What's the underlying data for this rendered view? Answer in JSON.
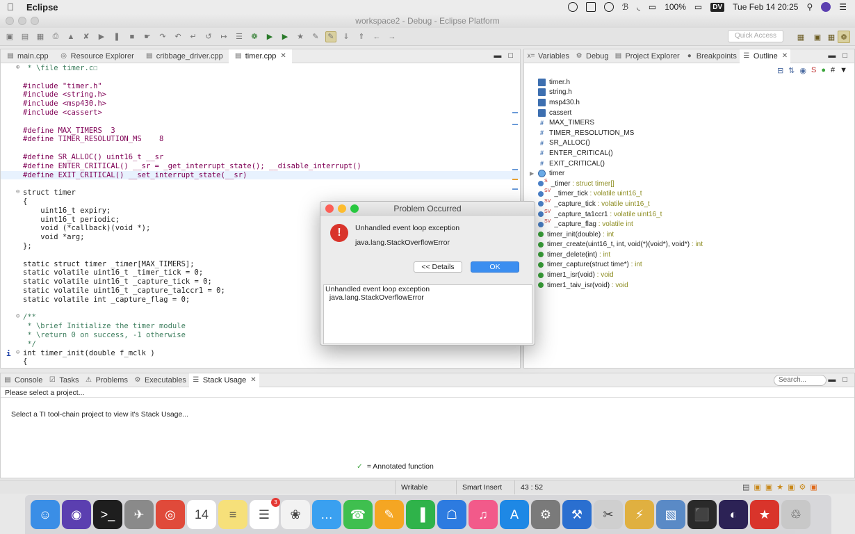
{
  "menubar": {
    "app": "Eclipse",
    "battery": "100%",
    "user_badge": "DV",
    "clock": "Tue Feb 14  20:25"
  },
  "window": {
    "title": "workspace2 - Debug - Eclipse Platform"
  },
  "toolbar": {
    "quick_access_placeholder": "Quick Access"
  },
  "editor": {
    "tabs": [
      {
        "label": "main.cpp",
        "icon": "file-icon"
      },
      {
        "label": "Resource Explorer",
        "icon": "compass-icon"
      },
      {
        "label": "cribbage_driver.cpp",
        "icon": "file-icon"
      },
      {
        "label": "timer.cpp",
        "icon": "file-icon",
        "active": true
      }
    ],
    "code": [
      " * \\file timer.c☐",
      "",
      "#include \"timer.h\"",
      "#include <string.h>",
      "#include <msp430.h>",
      "#include <cassert>",
      "",
      "#define MAX_TIMERS  3",
      "#define TIMER_RESOLUTION_MS    8",
      "",
      "#define SR_ALLOC() uint16_t __sr",
      "#define ENTER_CRITICAL() __sr = _get_interrupt_state(); __disable_interrupt()",
      "#define EXIT_CRITICAL() __set_interrupt_state(__sr)",
      "",
      "struct timer",
      "{",
      "    uint16_t expiry;",
      "    uint16_t periodic;",
      "    void (*callback)(void *);",
      "    void *arg;",
      "};",
      "",
      "static struct timer _timer[MAX_TIMERS];",
      "static volatile uint16_t _timer_tick = 0;",
      "static volatile uint16_t _capture_tick = 0;",
      "static volatile uint16_t _capture_ta1ccr1 = 0;",
      "static volatile int _capture_flag = 0;",
      "",
      "/**",
      " * \\brief Initialize the timer module",
      " * \\return 0 on success, -1 otherwise",
      " */",
      "int timer_init(double f_mclk )",
      "{"
    ]
  },
  "right_panel": {
    "tabs": [
      {
        "label": "Variables",
        "icon": "variables-icon"
      },
      {
        "label": "Debug",
        "icon": "debug-icon"
      },
      {
        "label": "Project Explorer",
        "icon": "folder-icon"
      },
      {
        "label": "Breakpoints",
        "icon": "breakpoints-icon"
      },
      {
        "label": "Outline",
        "icon": "outline-icon",
        "active": true
      }
    ],
    "outline": [
      {
        "name": "timer.h",
        "kind": "include"
      },
      {
        "name": "string.h",
        "kind": "include"
      },
      {
        "name": "msp430.h",
        "kind": "include"
      },
      {
        "name": "cassert",
        "kind": "include"
      },
      {
        "name": "MAX_TIMERS",
        "kind": "macro"
      },
      {
        "name": "TIMER_RESOLUTION_MS",
        "kind": "macro"
      },
      {
        "name": "SR_ALLOC()",
        "kind": "macro"
      },
      {
        "name": "ENTER_CRITICAL()",
        "kind": "macro"
      },
      {
        "name": "EXIT_CRITICAL()",
        "kind": "macro"
      },
      {
        "name": "timer",
        "kind": "struct"
      },
      {
        "name": "_timer",
        "type": " : struct timer[]",
        "kind": "var",
        "mod": "S"
      },
      {
        "name": "_timer_tick",
        "type": " : volatile uint16_t",
        "kind": "var",
        "mod": "SV"
      },
      {
        "name": "_capture_tick",
        "type": " : volatile uint16_t",
        "kind": "var",
        "mod": "SV"
      },
      {
        "name": "_capture_ta1ccr1",
        "type": " : volatile uint16_t",
        "kind": "var",
        "mod": "SV"
      },
      {
        "name": "_capture_flag",
        "type": " : volatile int",
        "kind": "var",
        "mod": "SV"
      },
      {
        "name": "timer_init(double)",
        "type": " : int",
        "kind": "func"
      },
      {
        "name": "timer_create(uint16_t, int, void(*)(void*), void*)",
        "type": " : int",
        "kind": "func"
      },
      {
        "name": "timer_delete(int)",
        "type": " : int",
        "kind": "func"
      },
      {
        "name": "timer_capture(struct time*)",
        "type": " : int",
        "kind": "func"
      },
      {
        "name": "timer1_isr(void)",
        "type": " : void",
        "kind": "func"
      },
      {
        "name": "timer1_taiv_isr(void)",
        "type": " : void",
        "kind": "func"
      }
    ]
  },
  "bottom_panel": {
    "tabs": [
      {
        "label": "Console"
      },
      {
        "label": "Tasks"
      },
      {
        "label": "Problems"
      },
      {
        "label": "Executables"
      },
      {
        "label": "Stack Usage",
        "active": true
      }
    ],
    "search_placeholder": "Search...",
    "header_text": "Please select a project...",
    "body_text": "Select a TI tool-chain project to view it's Stack Usage...",
    "legend_text": "= Annotated function"
  },
  "status": {
    "writable": "Writable",
    "insert_mode": "Smart Insert",
    "position": "43 : 52"
  },
  "dialog": {
    "title": "Problem Occurred",
    "message": "Unhandled event loop exception",
    "detail": "java.lang.StackOverflowError",
    "details_button": "<< Details",
    "ok_button": "OK",
    "details_text": "Unhandled event loop exception\n  java.lang.StackOverflowError"
  },
  "dock": [
    {
      "name": "finder-icon",
      "color": "#3a8ee6",
      "glyph": "☺"
    },
    {
      "name": "siri-icon",
      "color": "#5b3fb0",
      "glyph": "◉"
    },
    {
      "name": "terminal-icon",
      "color": "#1e1e1e",
      "glyph": ">_"
    },
    {
      "name": "launchpad-icon",
      "color": "#8a8a8a",
      "glyph": "✈"
    },
    {
      "name": "chrome-icon",
      "color": "#e04a3a",
      "glyph": "◎"
    },
    {
      "name": "calendar-icon",
      "color": "#ffffff",
      "glyph": "14"
    },
    {
      "name": "notes-icon",
      "color": "#f6e07a",
      "glyph": "≡"
    },
    {
      "name": "reminders-icon",
      "color": "#ffffff",
      "glyph": "☰",
      "badge": "3"
    },
    {
      "name": "photos-icon",
      "color": "#f2f2f2",
      "glyph": "❀"
    },
    {
      "name": "messages-icon",
      "color": "#3aa0f0",
      "glyph": "…"
    },
    {
      "name": "facetime-icon",
      "color": "#3fbf4f",
      "glyph": "☎"
    },
    {
      "name": "pages-icon",
      "color": "#f5a623",
      "glyph": "✎"
    },
    {
      "name": "numbers-icon",
      "color": "#2fb34a",
      "glyph": "▐"
    },
    {
      "name": "keynote-icon",
      "color": "#2d7be0",
      "glyph": "☖"
    },
    {
      "name": "itunes-icon",
      "color": "#f25a8a",
      "glyph": "♫"
    },
    {
      "name": "appstore-icon",
      "color": "#1e88e5",
      "glyph": "A"
    },
    {
      "name": "system-preferences-icon",
      "color": "#7a7a7a",
      "glyph": "⚙"
    },
    {
      "name": "xcode-icon",
      "color": "#2a6fd0",
      "glyph": "⚒"
    },
    {
      "name": "instruments-icon",
      "color": "#cfcfcf",
      "glyph": "✂"
    },
    {
      "name": "circuit-icon",
      "color": "#e0b040",
      "glyph": "⚡"
    },
    {
      "name": "preview-icon",
      "color": "#5a8ac6",
      "glyph": "▧"
    },
    {
      "name": "chip-icon",
      "color": "#2a2a2a",
      "glyph": "⬛"
    },
    {
      "name": "eclipse-icon",
      "color": "#2c2255",
      "glyph": "◐"
    },
    {
      "name": "ti-icon",
      "color": "#d9342b",
      "glyph": "★"
    },
    {
      "name": "trash-icon",
      "color": "#c8c8c8",
      "glyph": "♲"
    }
  ]
}
